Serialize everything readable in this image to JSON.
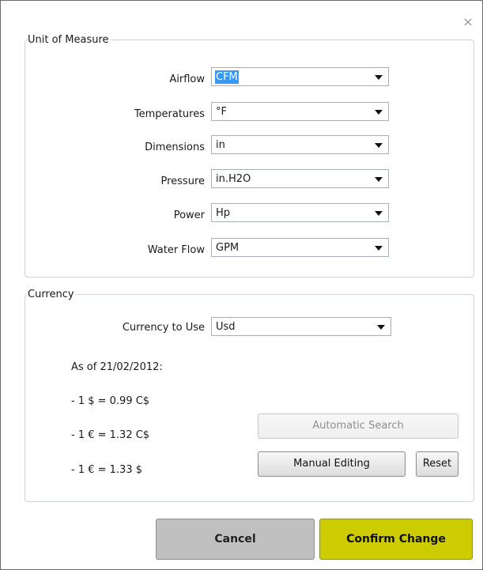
{
  "dialog": {
    "close_glyph": "×"
  },
  "units": {
    "legend": "Unit of Measure",
    "rows": [
      {
        "label": "Airflow",
        "value": "CFM"
      },
      {
        "label": "Temperatures",
        "value": "°F"
      },
      {
        "label": "Dimensions",
        "value": "in"
      },
      {
        "label": "Pressure",
        "value": "in.H2O"
      },
      {
        "label": "Power",
        "value": "Hp"
      },
      {
        "label": "Water Flow",
        "value": "GPM"
      }
    ]
  },
  "currency": {
    "legend": "Currency",
    "use_label": "Currency to Use",
    "use_value": "Usd",
    "as_of": "As of 21/02/2012:",
    "rates": [
      "- 1 $ = 0.99 C$",
      "- 1 € = 1.32 C$",
      "- 1 € = 1.33 $"
    ],
    "automatic_search": "Automatic Search",
    "manual_editing": "Manual Editing",
    "reset": "Reset"
  },
  "footer": {
    "cancel": "Cancel",
    "confirm": "Confirm Change"
  },
  "colors": {
    "confirm_bg": "#cccc00",
    "cancel_bg": "#c0c0c0",
    "selection": "#3399ff"
  }
}
